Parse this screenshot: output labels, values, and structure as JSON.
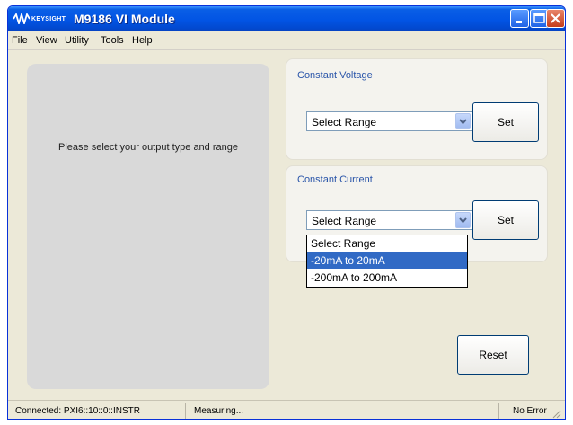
{
  "window": {
    "brand_text": "KEYSIGHT",
    "title": "M9186 VI Module",
    "controls": [
      "minimize-icon",
      "maximize-icon",
      "close-icon"
    ]
  },
  "menu": {
    "items": [
      "File",
      "View",
      "Utility",
      "Tools",
      "Help"
    ]
  },
  "left_panel": {
    "message": "Please select your output type and range"
  },
  "constant_voltage": {
    "label": "Constant  Voltage",
    "range_value": "Select Range",
    "set_label": "Set"
  },
  "constant_current": {
    "label": "Constant  Current",
    "range_value": "Select Range",
    "set_label": "Set",
    "dropdown_options": [
      "Select Range",
      "-20mA to 20mA",
      "-200mA to 200mA"
    ],
    "highlighted_option": "-20mA to 20mA"
  },
  "reset_label": "Reset",
  "status": {
    "connection": "Connected: PXI6::10::0::INSTR",
    "state": "Measuring...",
    "error": "No Error"
  },
  "colors": {
    "titlebar": "#0254e4",
    "group_label": "#2a55a9",
    "selection": "#316ac5"
  }
}
